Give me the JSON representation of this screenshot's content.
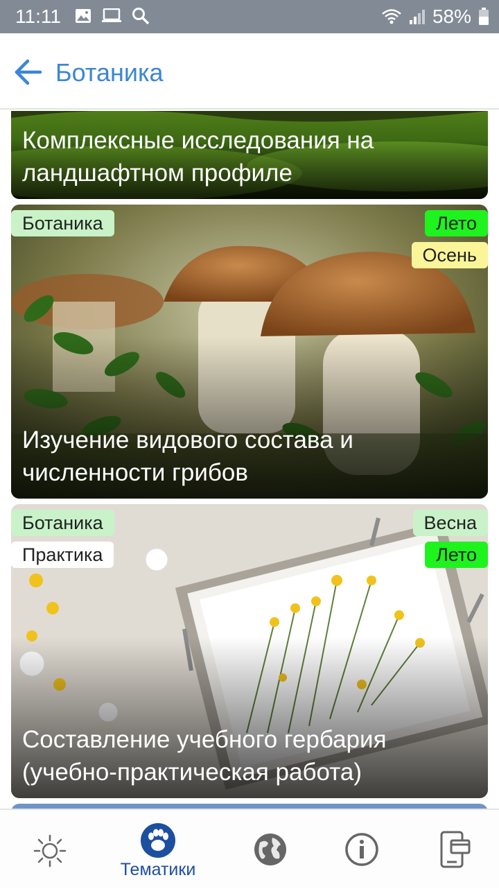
{
  "status_bar": {
    "time": "11:11",
    "battery": "58%"
  },
  "app_bar": {
    "title": "Ботаника"
  },
  "cards": [
    {
      "title_line1": "Комплексные исследования на",
      "title_line2": "ландшафтном профиле"
    },
    {
      "category": "Ботаника",
      "seasons": [
        "Лето",
        "Осень"
      ],
      "title_line1": "Изучение видового состава и",
      "title_line2": "численности грибов"
    },
    {
      "category": "Ботаника",
      "type": "Практика",
      "seasons": [
        "Весна",
        "Лето"
      ],
      "title_line1": "Составление учебного гербария",
      "title_line2": "(учебно-практическая работа)"
    }
  ],
  "bottom_nav": {
    "items": [
      {
        "icon": "sun-icon",
        "label": ""
      },
      {
        "icon": "paw-icon",
        "label": "Тематики"
      },
      {
        "icon": "globe-icon",
        "label": ""
      },
      {
        "icon": "info-icon",
        "label": ""
      },
      {
        "icon": "phone-card-icon",
        "label": ""
      }
    ],
    "active_color": "#1d4fa0"
  },
  "colors": {
    "accent": "#3b86d6",
    "summer_tag": "#1ef31e",
    "autumn_tag": "#fbf59a",
    "category_tag": "#c9f2c9"
  }
}
